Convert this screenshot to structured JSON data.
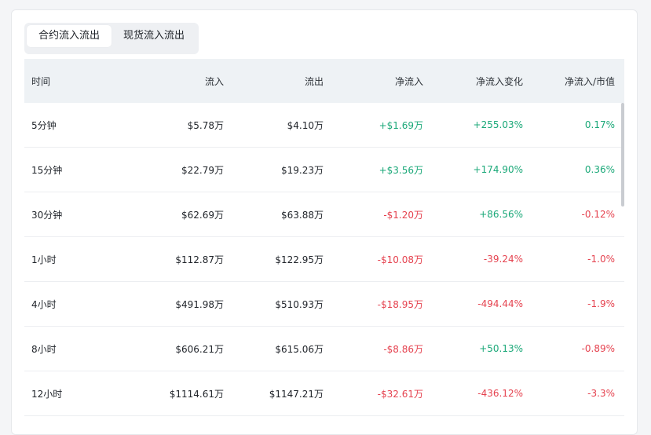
{
  "tabs": [
    {
      "label": "合约流入流出",
      "active": true
    },
    {
      "label": "现货流入流出",
      "active": false
    }
  ],
  "columns": [
    "时间",
    "流入",
    "流出",
    "净流入",
    "净流入变化",
    "净流入/市值"
  ],
  "rows": [
    {
      "time": "5分钟",
      "inflow": "$5.78万",
      "outflow": "$4.10万",
      "net": "+$1.69万",
      "net_dir": "pos",
      "change": "+255.03%",
      "change_dir": "pos",
      "ratio": "0.17%",
      "ratio_dir": "pos"
    },
    {
      "time": "15分钟",
      "inflow": "$22.79万",
      "outflow": "$19.23万",
      "net": "+$3.56万",
      "net_dir": "pos",
      "change": "+174.90%",
      "change_dir": "pos",
      "ratio": "0.36%",
      "ratio_dir": "pos"
    },
    {
      "time": "30分钟",
      "inflow": "$62.69万",
      "outflow": "$63.88万",
      "net": "-$1.20万",
      "net_dir": "neg",
      "change": "+86.56%",
      "change_dir": "pos",
      "ratio": "-0.12%",
      "ratio_dir": "neg"
    },
    {
      "time": "1小时",
      "inflow": "$112.87万",
      "outflow": "$122.95万",
      "net": "-$10.08万",
      "net_dir": "neg",
      "change": "-39.24%",
      "change_dir": "neg",
      "ratio": "-1.0%",
      "ratio_dir": "neg"
    },
    {
      "time": "4小时",
      "inflow": "$491.98万",
      "outflow": "$510.93万",
      "net": "-$18.95万",
      "net_dir": "neg",
      "change": "-494.44%",
      "change_dir": "neg",
      "ratio": "-1.9%",
      "ratio_dir": "neg"
    },
    {
      "time": "8小时",
      "inflow": "$606.21万",
      "outflow": "$615.06万",
      "net": "-$8.86万",
      "net_dir": "neg",
      "change": "+50.13%",
      "change_dir": "pos",
      "ratio": "-0.89%",
      "ratio_dir": "neg"
    },
    {
      "time": "12小时",
      "inflow": "$1114.61万",
      "outflow": "$1147.21万",
      "net": "-$32.61万",
      "net_dir": "neg",
      "change": "-436.12%",
      "change_dir": "neg",
      "ratio": "-3.3%",
      "ratio_dir": "neg"
    }
  ],
  "colors": {
    "positive": "#1aa878",
    "negative": "#e5424f",
    "header_bg": "#eef2f5"
  }
}
